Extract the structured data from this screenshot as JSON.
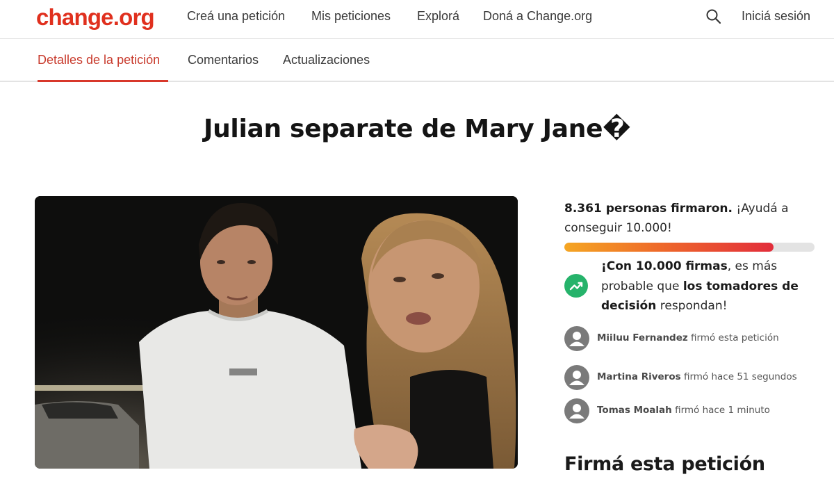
{
  "header": {
    "logo": "change.org",
    "nav": [
      "Creá una petición",
      "Mis peticiones",
      "Explorá",
      "Doná a Change.org"
    ],
    "login": "Iniciá sesión",
    "search_icon": "search-icon"
  },
  "tabs": {
    "items": [
      "Detalles de la petición",
      "Comentarios",
      "Actualizaciones"
    ],
    "active_color": "#c8392b"
  },
  "petition": {
    "title": "Julian separate de Mary Jane�"
  },
  "stats": {
    "signed_count": "8.361 personas firmaron.",
    "signed_rest": " ¡Ayudá a conseguir 10.000!",
    "progress": 0.836,
    "goal_a": "¡Con 10.000 firmas",
    "goal_b": ", es más probable que ",
    "goal_c": "los tomadores de decisión",
    "goal_d": " respondan!",
    "trend_icon": "trending-up-icon",
    "accent": "#26b36b"
  },
  "signers": [
    {
      "name": "Miiluu Fernandez",
      "action": " firmó esta petición"
    },
    {
      "name": "Martina Riveros",
      "action": " firmó hace 51 segundos"
    },
    {
      "name": "Tomas Moalah",
      "action": " firmó hace 1 minuto"
    }
  ],
  "sign_heading": "Firmá esta petición",
  "colors": {
    "brand": "#e0301e",
    "progress_start": "#f5a623",
    "progress_end": "#e22d3b"
  }
}
